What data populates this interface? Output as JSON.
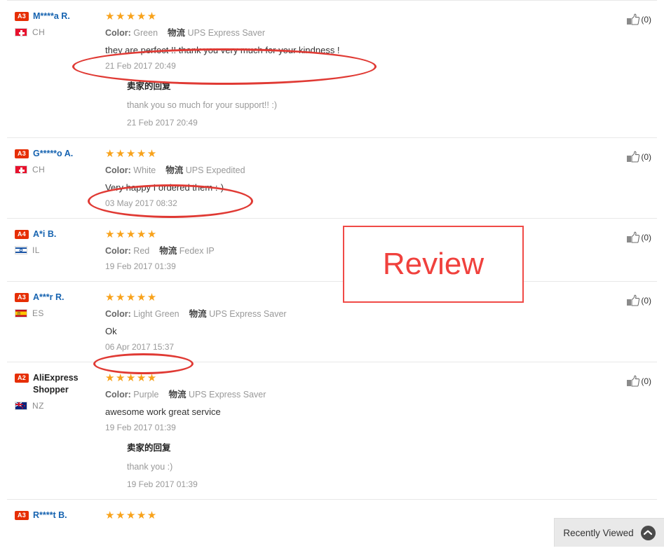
{
  "annotations": {
    "review_box_label": "Review"
  },
  "helpful": {
    "count_label": "(0)",
    "icon": "thumbs-up-icon"
  },
  "attr_labels": {
    "color": "Color:",
    "logistics": "物流"
  },
  "seller_reply_title": "卖家的回复",
  "recently_viewed": {
    "label": "Recently Viewed",
    "icon": "chevron-up-icon"
  },
  "reviews": [
    {
      "level": "A3",
      "name": "M****a R.",
      "name_style": "link",
      "country_code": "CH",
      "flag": "flag-ch",
      "stars": "★★★★★",
      "color_value": "Green",
      "logistics_value": "UPS Express Saver",
      "text": "they are perfect !! thank you very much for your kindness !",
      "date": "21 Feb 2017 20:49",
      "reply_text": "thank you so much for your support!! :)",
      "reply_date": "21 Feb 2017 20:49",
      "helpful_count": "(0)"
    },
    {
      "level": "A3",
      "name": "G*****o A.",
      "name_style": "link",
      "country_code": "CH",
      "flag": "flag-ch",
      "stars": "★★★★★",
      "color_value": "White",
      "logistics_value": "UPS Expedited",
      "text": "Very happy I ordered them :-)",
      "date": "03 May 2017 08:32",
      "reply_text": "",
      "reply_date": "",
      "helpful_count": "(0)"
    },
    {
      "level": "A4",
      "name": "A*i B.",
      "name_style": "link",
      "country_code": "IL",
      "flag": "flag-il",
      "stars": "★★★★★",
      "color_value": "Red",
      "logistics_value": "Fedex IP",
      "text": "",
      "date": "19 Feb 2017 01:39",
      "reply_text": "",
      "reply_date": "",
      "helpful_count": "(0)"
    },
    {
      "level": "A3",
      "name": "A***r R.",
      "name_style": "link",
      "country_code": "ES",
      "flag": "flag-es",
      "stars": "★★★★★",
      "color_value": "Light Green",
      "logistics_value": "UPS Express Saver",
      "text": "Ok",
      "date": "06 Apr 2017 15:37",
      "reply_text": "",
      "reply_date": "",
      "helpful_count": "(0)"
    },
    {
      "level": "A2",
      "name": "AliExpress Shopper",
      "name_style": "plain",
      "country_code": "NZ",
      "flag": "flag-nz",
      "stars": "★★★★★",
      "color_value": "Purple",
      "logistics_value": "UPS Express Saver",
      "text": "awesome work great service",
      "date": "19 Feb 2017 01:39",
      "reply_text": "thank you :)",
      "reply_date": "19 Feb 2017 01:39",
      "helpful_count": "(0)"
    },
    {
      "level": "A3",
      "name": "R****t B.",
      "name_style": "link",
      "country_code": "",
      "flag": "",
      "stars": "★★★★★",
      "color_value": "",
      "logistics_value": "",
      "text": "",
      "date": "",
      "reply_text": "",
      "reply_date": "",
      "helpful_count": ""
    }
  ]
}
